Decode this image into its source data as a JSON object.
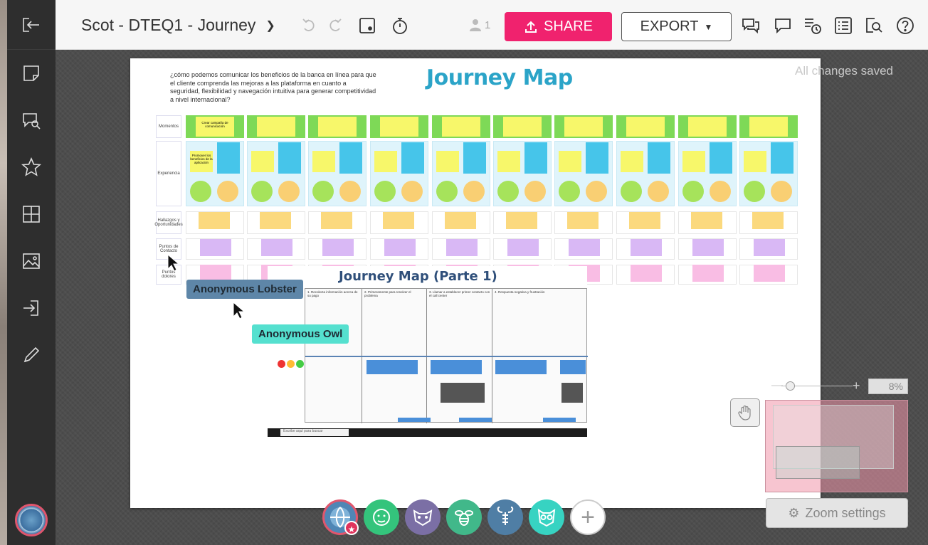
{
  "app": {
    "board_title": "Scot - DTEQ1 - Journey",
    "share_label": "SHARE",
    "export_label": "EXPORT",
    "user_count": "1",
    "saved_status": "All changes saved"
  },
  "sidebar": {
    "items": [
      {
        "name": "exit",
        "icon": "sign-out-icon"
      },
      {
        "name": "sticky-note",
        "icon": "sticky-note-icon"
      },
      {
        "name": "comment-search",
        "icon": "chat-search-icon"
      },
      {
        "name": "favorites",
        "icon": "star-icon"
      },
      {
        "name": "templates",
        "icon": "grid-icon"
      },
      {
        "name": "image",
        "icon": "image-icon"
      },
      {
        "name": "import",
        "icon": "sign-in-icon"
      },
      {
        "name": "draw",
        "icon": "pencil-icon"
      }
    ]
  },
  "board": {
    "question": "¿cómo podemos comunicar los beneficios de la banca en línea para que el cliente comprenda las mejoras a las plataforma en cuanto a seguridad, flexibilidad y navegación intuitiva para generar competitividad a nivel internacional?",
    "title": "Journey Map",
    "row_labels": {
      "momentos": "Momentos",
      "experiencia": "Experiencia",
      "hallazgos": "Hallazgos y Oportunidades",
      "puntos": "Puntos de Contacto",
      "dolores": "Puntos dolores"
    },
    "first_moment_note": "Crear campaña de comunicación",
    "first_exp_note": "Promover los beneficios de la aplicación",
    "embed_title": "Journey Map (Parte 1)",
    "embed_steps": [
      "1. Recolecta información acerca de su pago",
      "2. Primeramente para resolver el problema",
      "3. Llamar a establecer primer contacto con el call center",
      "4. Respuesta negativa y frustración"
    ],
    "embed_search": "Escribe aquí para buscar"
  },
  "collaborators": {
    "lobster_tag": "Anonymous Lobster",
    "owl_tag": "Anonymous Owl"
  },
  "zoom": {
    "percent": "8%",
    "settings_label": "Zoom settings"
  },
  "participants": [
    {
      "name": "self",
      "icon": "globe-icon",
      "color": "#4f86b5"
    },
    {
      "name": "gorilla",
      "icon": "gorilla-icon",
      "color": "#34c47c"
    },
    {
      "name": "raccoon",
      "icon": "raccoon-icon",
      "color": "#7b6fa5"
    },
    {
      "name": "bee",
      "icon": "bee-icon",
      "color": "#41b88a"
    },
    {
      "name": "lobster",
      "icon": "lobster-icon",
      "color": "#4f7ea5"
    },
    {
      "name": "owl",
      "icon": "owl-icon",
      "color": "#37d3c2"
    }
  ]
}
